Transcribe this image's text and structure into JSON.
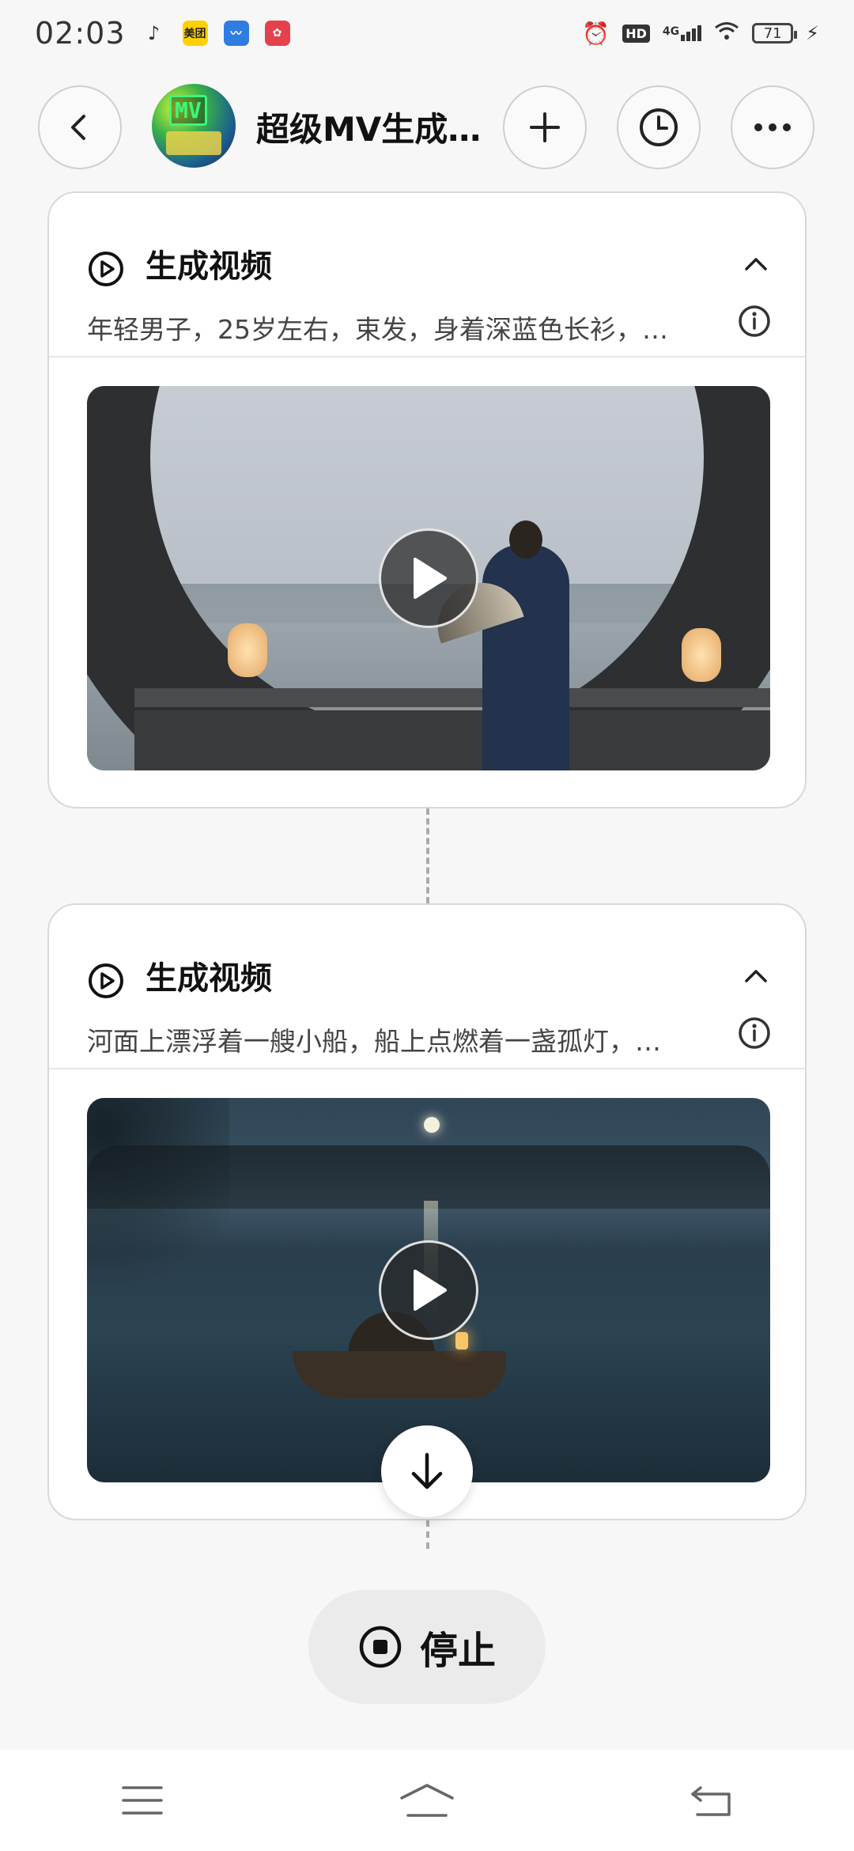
{
  "status_bar": {
    "time": "02:03",
    "apps": [
      {
        "icon": "music-note-icon"
      },
      {
        "label": "美团",
        "color": "#ffd100"
      },
      {
        "icon": "stocks-app-icon",
        "color": "#2f7de1"
      },
      {
        "icon": "game-app-icon",
        "color": "#e5414d"
      }
    ],
    "hd": "HD",
    "network": "4G",
    "battery": "71"
  },
  "header": {
    "title": "超级MV生成…",
    "avatar_text": "MV"
  },
  "cards": [
    {
      "label": "生成视频",
      "description": "年轻男子，25岁左右，束发，身着深蓝色长衫，…"
    },
    {
      "label": "生成视频",
      "description": "河面上漂浮着一艘小船，船上点燃着一盏孤灯，…"
    }
  ],
  "stop_button": {
    "label": "停止"
  },
  "colors": {
    "background": "#f7f7f7",
    "card_border": "#d9d9d9",
    "stop_bg": "#ebebeb"
  }
}
